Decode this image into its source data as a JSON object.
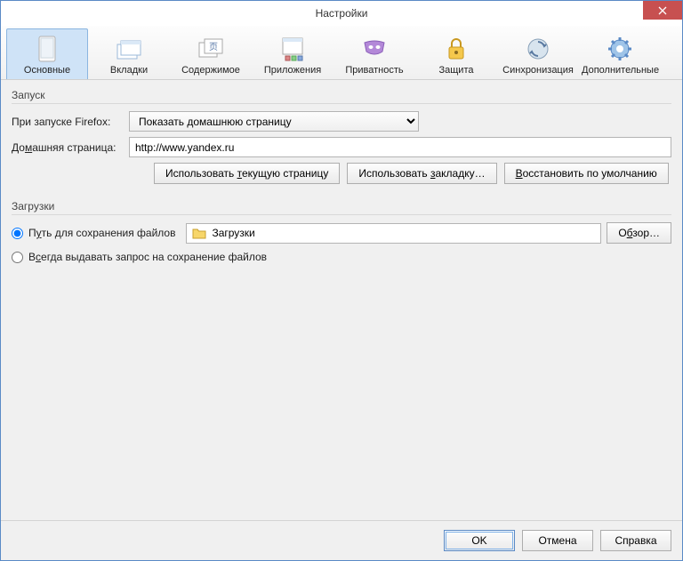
{
  "window": {
    "title": "Настройки"
  },
  "tabs": [
    {
      "label": "Основные"
    },
    {
      "label": "Вкладки"
    },
    {
      "label": "Содержимое"
    },
    {
      "label": "Приложения"
    },
    {
      "label": "Приватность"
    },
    {
      "label": "Защита"
    },
    {
      "label": "Синхронизация"
    },
    {
      "label": "Дополнительные"
    }
  ],
  "startup": {
    "group_label": "Запуск",
    "launch_label": "При запуске Firefox:",
    "launch_value": "Показать домашнюю страницу",
    "homepage_label": "Домашняя страница:",
    "homepage_value": "http://www.yandex.ru",
    "btn_use_current": "Использовать текущую страницу",
    "btn_use_bookmark": "Использовать закладку…",
    "btn_restore_default": "Восстановить по умолчанию"
  },
  "downloads": {
    "group_label": "Загрузки",
    "radio_save_to": "Путь для сохранения файлов",
    "folder_name": "Загрузки",
    "btn_browse": "Обзор…",
    "radio_always_ask": "Всегда выдавать запрос на сохранение файлов"
  },
  "footer": {
    "ok": "OK",
    "cancel": "Отмена",
    "help": "Справка"
  }
}
